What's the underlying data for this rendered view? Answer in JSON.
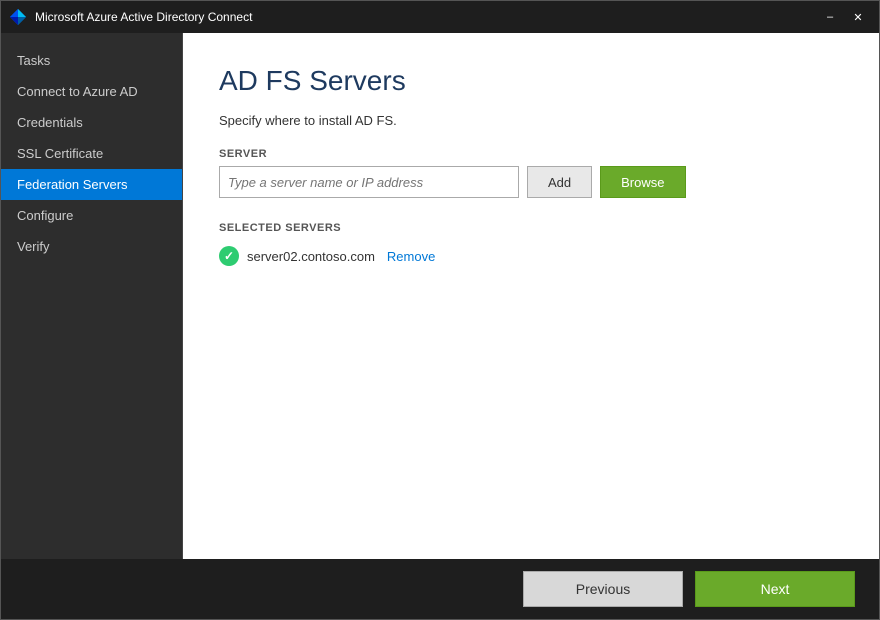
{
  "window": {
    "title": "Microsoft Azure Active Directory Connect",
    "minimize_label": "–",
    "close_label": "✕"
  },
  "sidebar": {
    "items": [
      {
        "id": "tasks",
        "label": "Tasks",
        "active": false
      },
      {
        "id": "connect-azure-ad",
        "label": "Connect to Azure AD",
        "active": false
      },
      {
        "id": "credentials",
        "label": "Credentials",
        "active": false
      },
      {
        "id": "ssl-certificate",
        "label": "SSL Certificate",
        "active": false
      },
      {
        "id": "federation-servers",
        "label": "Federation Servers",
        "active": true
      },
      {
        "id": "configure",
        "label": "Configure",
        "active": false
      },
      {
        "id": "verify",
        "label": "Verify",
        "active": false
      }
    ]
  },
  "main": {
    "page_title": "AD FS Servers",
    "subtitle": "Specify where to install AD FS.",
    "server_label": "SERVER",
    "server_placeholder": "Type a server name or IP address",
    "add_button": "Add",
    "browse_button": "Browse",
    "selected_servers_label": "SELECTED SERVERS",
    "selected_servers": [
      {
        "name": "server02.contoso.com",
        "remove_label": "Remove"
      }
    ]
  },
  "footer": {
    "previous_label": "Previous",
    "next_label": "Next"
  }
}
